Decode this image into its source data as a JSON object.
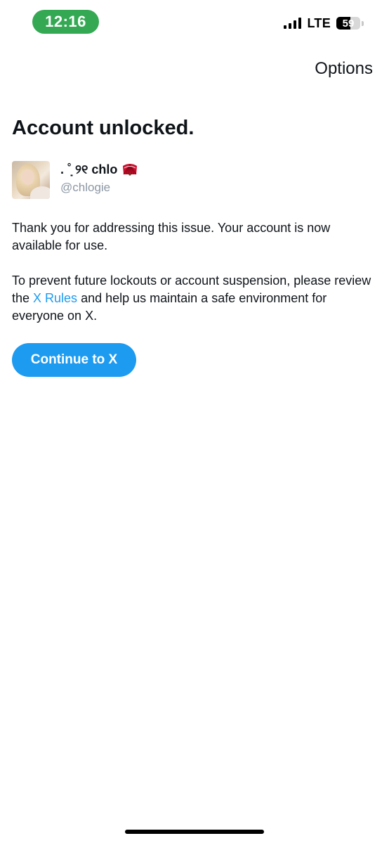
{
  "status_bar": {
    "time": "12:16",
    "network": "LTE",
    "battery_level": "59",
    "battery_fraction": 0.59,
    "time_pill_color": "#34a853",
    "signal_bars": 4,
    "signal_icon": "cellular-signal-icon",
    "battery_icon": "battery-icon"
  },
  "header": {
    "options_label": "Options"
  },
  "main": {
    "title": "Account unlocked.",
    "account": {
      "display_name": ". ˚̣̣̣̣ ୨୧ chlo",
      "name_emoji_icon": "folding-fan-icon",
      "handle": "@chlogie",
      "avatar_icon": "profile-photo-avatar"
    },
    "paragraph_1": "Thank you for addressing this issue. Your account is now available for use.",
    "paragraph_2_before": "To prevent future lockouts or account suspension, please review the ",
    "paragraph_2_link": "X Rules",
    "paragraph_2_after": " and help us maintain a safe environment for everyone on X.",
    "continue_label": "Continue to X"
  },
  "colors": {
    "accent": "#1d9bf0",
    "text": "#0f1419",
    "secondary_text": "#8c97a3",
    "background": "#ffffff"
  }
}
